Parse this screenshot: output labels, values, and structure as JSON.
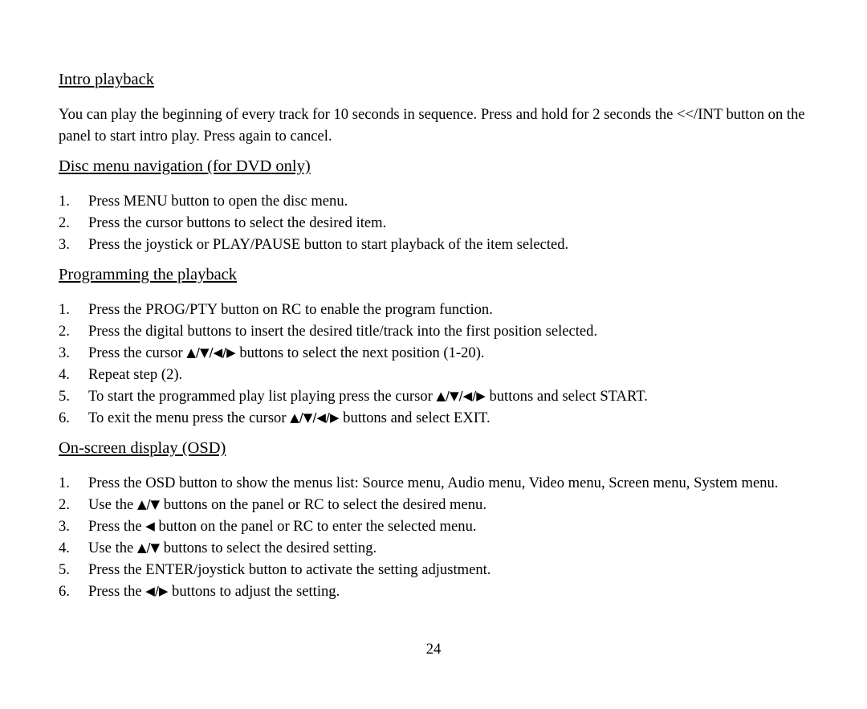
{
  "document": {
    "page_number": "24"
  },
  "sections": [
    {
      "heading": "Intro playback",
      "paragraph": "You can play the beginning of every track for 10 seconds in sequence. Press and hold for 2 seconds the <</INT button on the panel to start intro play. Press again to cancel."
    },
    {
      "heading": "Disc menu navigation (for DVD only)",
      "steps": [
        {
          "num": "1.",
          "text": "Press MENU button to open the disc menu."
        },
        {
          "num": "2.",
          "text": "Press the cursor buttons to select the desired item."
        },
        {
          "num": "3.",
          "text": "Press the joystick or PLAY/PAUSE button to start playback of the item selected."
        }
      ]
    },
    {
      "heading": "Programming the playback",
      "steps": [
        {
          "num": "1.",
          "text": "Press the PROG/PTY button on RC to enable the program function."
        },
        {
          "num": "2.",
          "text": "Press the digital buttons to insert the desired title/track into the first position selected."
        },
        {
          "num": "3.",
          "pre": "Press the cursor ",
          "arrows": "▲/▼/◀/▶",
          "post": " buttons to select the next position (1-20)."
        },
        {
          "num": "4.",
          "text": "Repeat step (2)."
        },
        {
          "num": "5.",
          "pre": "To start the programmed play list playing press the cursor ",
          "arrows": "▲/▼/◀/▶",
          "post": " buttons and select START."
        },
        {
          "num": "6.",
          "pre": "To exit the menu press the cursor ",
          "arrows": "▲/▼/◀/▶",
          "post": " buttons and select EXIT."
        }
      ]
    },
    {
      "heading": "On-screen display (OSD)",
      "steps": [
        {
          "num": "1.",
          "text": "Press the OSD button to show the menus list: Source menu, Audio menu, Video menu, Screen menu, System menu."
        },
        {
          "num": "2.",
          "pre": "Use the ",
          "arrows": "▲/▼",
          "post": " buttons on the panel or RC to select the desired menu."
        },
        {
          "num": "3.",
          "pre": "Press the ",
          "arrows": "◀",
          "post": " button on the panel or RC to enter the selected menu."
        },
        {
          "num": "4.",
          "pre": "Use the ",
          "arrows": "▲/▼",
          "post": " buttons to select the desired setting."
        },
        {
          "num": "5.",
          "text": "Press the ENTER/joystick button to activate the setting adjustment."
        },
        {
          "num": "6.",
          "pre": "Press the ",
          "arrows": "◀/▶",
          "post": " buttons to adjust the setting."
        }
      ]
    }
  ]
}
